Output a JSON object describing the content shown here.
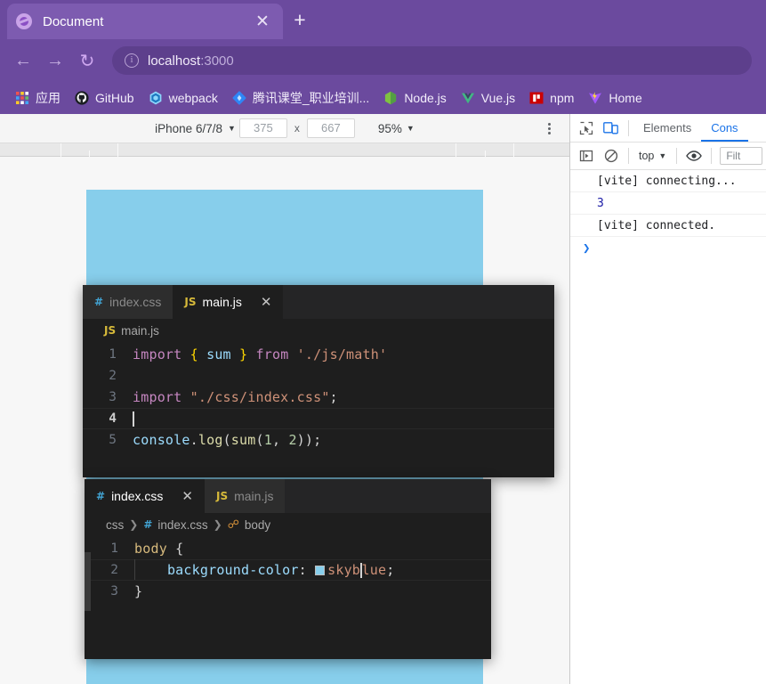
{
  "browser": {
    "tab": {
      "title": "Document",
      "favicon": "globe-icon",
      "close_label": "✕"
    },
    "new_tab_label": "+",
    "nav": {
      "back": "←",
      "forward": "→",
      "reload": "↻"
    },
    "omnibox": {
      "info_icon": "info-icon",
      "host": "localhost",
      "port": ":3000"
    },
    "bookmarks": [
      {
        "label": "应用",
        "icon": "apps-grid-icon"
      },
      {
        "label": "GitHub",
        "icon": "github-icon"
      },
      {
        "label": "webpack",
        "icon": "webpack-icon"
      },
      {
        "label": "腾讯课堂_职业培训...",
        "icon": "tencent-classroom-icon"
      },
      {
        "label": "Node.js",
        "icon": "nodejs-icon"
      },
      {
        "label": "Vue.js",
        "icon": "vuejs-icon"
      },
      {
        "label": "npm",
        "icon": "npm-icon"
      },
      {
        "label": "Home",
        "icon": "vite-icon"
      }
    ]
  },
  "device_toolbar": {
    "device": "iPhone 6/7/8",
    "width": "375",
    "height": "667",
    "times": "x",
    "zoom": "95%",
    "caret": "▼",
    "more_label": "more-options"
  },
  "devtools": {
    "toolbar": {
      "inspect_icon": "inspect-element-icon",
      "device_toggle_icon": "toggle-device-toolbar-icon",
      "tabs": [
        {
          "label": "Elements",
          "active": false
        },
        {
          "label": "Cons",
          "active": true
        }
      ]
    },
    "toolbar2": {
      "sidebar_icon": "console-sidebar-icon",
      "clear_icon": "clear-console-icon",
      "context": "top",
      "caret": "▼",
      "eye_icon": "live-expression-icon",
      "filter_placeholder": "Filt"
    },
    "console_entries": [
      {
        "text": "[vite] connecting...",
        "kind": "log"
      },
      {
        "text": "3",
        "kind": "number"
      },
      {
        "text": "[vite] connected.",
        "kind": "log"
      }
    ],
    "prompt": "❯"
  },
  "page": {
    "background_color": "#87ceeb"
  },
  "editor_js": {
    "tabs": [
      {
        "label": "index.css",
        "filetype": "css",
        "active": false,
        "close": ""
      },
      {
        "label": "main.js",
        "filetype": "js",
        "active": true,
        "close": "✕"
      }
    ],
    "breadcrumb": [
      {
        "label": "main.js",
        "icon": "js-file-icon"
      }
    ],
    "lines": [
      {
        "no": "1",
        "current": false
      },
      {
        "no": "2",
        "current": false
      },
      {
        "no": "3",
        "current": false
      },
      {
        "no": "4",
        "current": true
      },
      {
        "no": "5",
        "current": false
      }
    ],
    "code": {
      "l1_import": "import",
      "l1_open": " { ",
      "l1_sum": "sum",
      "l1_close": " } ",
      "l1_from": "from",
      "l1_path": " './js/math'",
      "l3_import": "import",
      "l3_path": " \"./css/index.css\"",
      "l3_semi": ";",
      "l5_console": "console",
      "l5_dot": ".",
      "l5_log": "log",
      "l5_p1": "(",
      "l5_sum": "sum",
      "l5_p2": "(",
      "l5_n1": "1",
      "l5_comma": ", ",
      "l5_n2": "2",
      "l5_tail": "));"
    }
  },
  "editor_css": {
    "tabs": [
      {
        "label": "index.css",
        "filetype": "css",
        "active": true,
        "close": "✕"
      },
      {
        "label": "main.js",
        "filetype": "js",
        "active": false,
        "close": ""
      }
    ],
    "breadcrumb": [
      {
        "label": "css",
        "icon": "folder-icon"
      },
      {
        "label": "index.css",
        "icon": "css-file-icon"
      },
      {
        "label": "body",
        "icon": "css-selector-icon"
      }
    ],
    "lines": [
      {
        "no": "1",
        "current": false
      },
      {
        "no": "2",
        "current": true
      },
      {
        "no": "3",
        "current": false
      }
    ],
    "code": {
      "l1_sel": "body ",
      "l1_brace": "{",
      "l2_prop": "background-color",
      "l2_colon": ": ",
      "l2_val_a": "skyb",
      "l2_val_b": "lue",
      "l2_semi": ";",
      "l3_brace": "}"
    },
    "swatch_color": "#87ceeb"
  },
  "colors": {
    "chrome": "#6b4a9e",
    "accent": "#1a73e8",
    "editor_bg": "#1e1e1e",
    "tabbar_bg": "#252526",
    "skyblue": "#87ceeb"
  }
}
